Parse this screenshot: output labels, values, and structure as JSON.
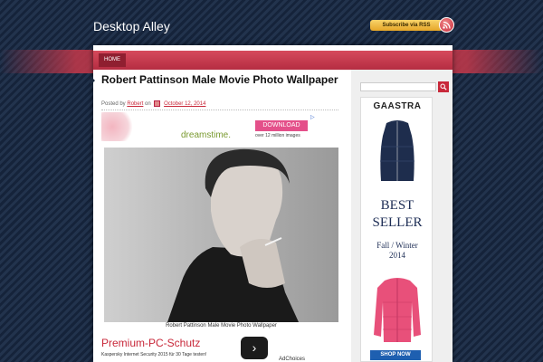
{
  "header": {
    "site_title": "Desktop Alley",
    "rss_label": "Subscribe via RSS"
  },
  "nav": {
    "home_label": "HOME"
  },
  "post": {
    "title": "Robert Pattinson Male Movie Photo Wallpaper",
    "posted_by_label": "Posted by",
    "author": "Robert",
    "on_label": "on",
    "date": "October 12, 2014",
    "caption": "Robert Pattinson Male Movie Photo Wallpaper"
  },
  "ad_top": {
    "logo": "dreamstime.",
    "button": "DOWNLOAD",
    "subtext": "over 12 million images"
  },
  "ad_bottom": {
    "title": "Premium-PC-Schutz",
    "subtext": "Kaspersky Internet Security 2015 für 30 Tage testen!",
    "arrow": "›",
    "adchoices": "AdChoices"
  },
  "sidebar": {
    "ad": {
      "logo": "GAASTRA",
      "headline_1": "BEST",
      "headline_2": "SELLER",
      "season_1": "Fall / Winter",
      "season_2": "2014",
      "shop_button": "SHOP NOW"
    }
  },
  "colors": {
    "accent": "#c8283a",
    "background": "#1b2a40"
  }
}
